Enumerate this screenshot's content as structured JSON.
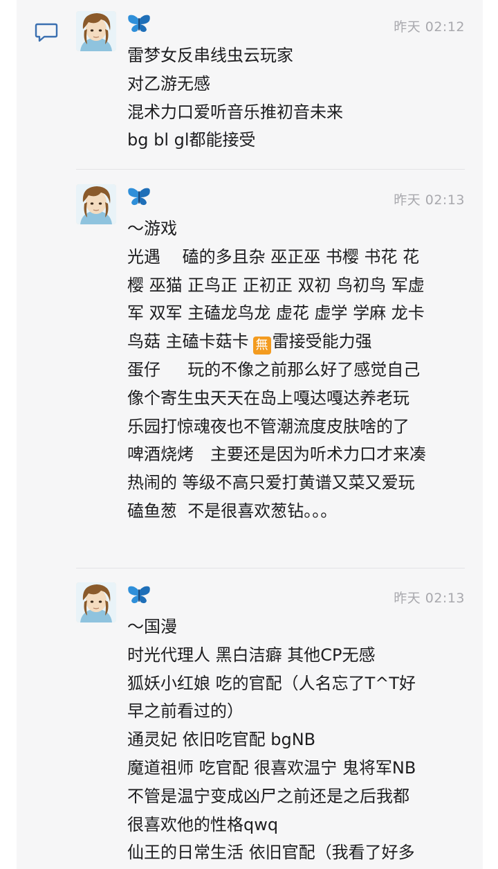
{
  "posts": [
    {
      "timestamp": "昨天 02:12",
      "lines": [
        "雷梦女反串线虫云玩家",
        "对乙游无感",
        "混术力口爱听音乐推初音未来",
        "bg bl gl都能接受"
      ]
    },
    {
      "timestamp": "昨天 02:13",
      "lines": [
        "～游戏",
        "光遇　 磕的多且杂 巫正巫 书樱 书花 花",
        "樱 巫猫 正鸟正 正初正 双初 鸟初鸟 军虚",
        "军 双军 主磕龙鸟龙 虚花 虚学 学麻 龙卡",
        "鸟菇 主磕卡菇卡",
        "蛋仔　  玩的不像之前那么好了感觉自己",
        "像个寄生虫天天在岛上嘎达嘎达养老玩",
        "乐园打惊魂夜也不管潮流度皮肤啥的了",
        "啤酒烧烤　主要还是因为听术力口才来凑",
        "热闹的 等级不高只爱打黄谱又菜又爱玩",
        "磕鱼葱  不是很喜欢葱钻。。。"
      ],
      "badge_text": "無",
      "badge_suffix": "雷接受能力强"
    },
    {
      "timestamp": "昨天 02:13",
      "lines": [
        "～国漫",
        "时光代理人 黑白洁癖 其他CP无感",
        "狐妖小红娘 吃的官配（人名忘了T^T好",
        "早之前看过的）",
        "通灵妃 依旧吃官配 bgNB",
        "魔道祖师 吃官配 很喜欢温宁 鬼将军NB",
        "不管是温宁变成凶尸之前还是之后我都",
        "很喜欢他的性格qwq",
        "仙王的日常生活 依旧官配（我看了好多"
      ]
    }
  ],
  "icons": {
    "reply": "comment-bubble-icon",
    "badge": "butterfly-icon"
  },
  "colors": {
    "card_bg": "#f6f6f7",
    "butterfly": "#2f8fd9",
    "timestamp": "#a8a8ad",
    "free_badge": "#f39b1f"
  }
}
